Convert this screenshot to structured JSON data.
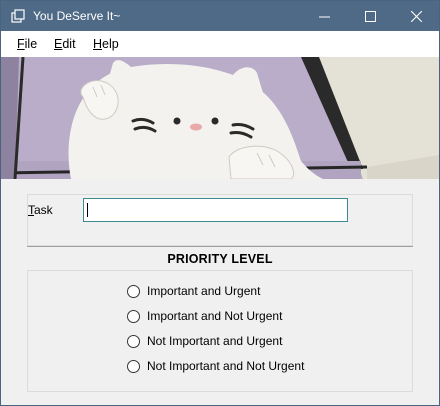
{
  "window": {
    "title": "You DeServe It~"
  },
  "menu": {
    "file": {
      "accel": "F",
      "rest": "ile"
    },
    "edit": {
      "accel": "E",
      "rest": "dit"
    },
    "help": {
      "accel": "H",
      "rest": "elp"
    }
  },
  "task": {
    "label_accel": "T",
    "label_rest": "ask",
    "value": ""
  },
  "priority": {
    "heading": "PRIORITY LEVEL",
    "options": [
      "Important and Urgent",
      "Important and Not Urgent",
      "Not Important and Urgent",
      "Not Important and Not Urgent"
    ],
    "selected": null
  },
  "colors": {
    "titlebar": "#4f6a86",
    "banner_background": "#b7abc9",
    "input_border": "#3d8a92"
  }
}
